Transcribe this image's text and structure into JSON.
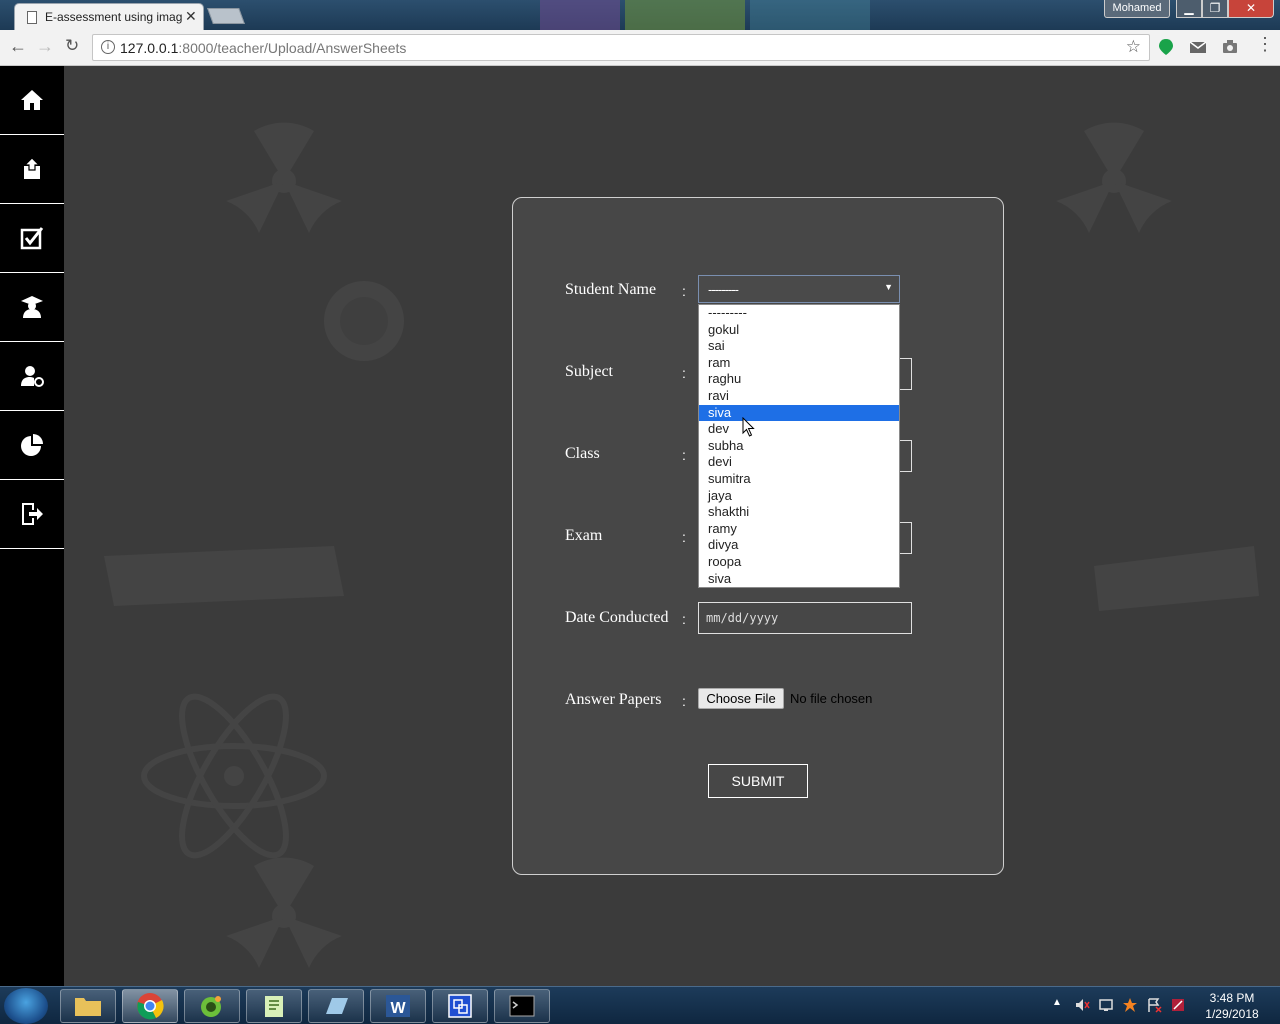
{
  "browser": {
    "tab_title": "E-assessment using imag",
    "user_name": "Mohamed",
    "url_host": "127.0.0.1",
    "url_rest": ":8000/teacher/Upload/AnswerSheets"
  },
  "sidebar": {
    "items": [
      {
        "icon": "home-icon"
      },
      {
        "icon": "upload-icon"
      },
      {
        "icon": "checkbox-icon"
      },
      {
        "icon": "student-icon"
      },
      {
        "icon": "user-settings-icon"
      },
      {
        "icon": "pie-chart-icon"
      },
      {
        "icon": "logout-icon"
      }
    ]
  },
  "form": {
    "student_label": "Student Name",
    "subject_label": "Subject",
    "class_label": "Class",
    "exam_label": "Exam",
    "date_label": "Date Conducted",
    "answers_label": "Answer Papers",
    "colon": ":",
    "student_selected": "---------",
    "date_placeholder": "mm/dd/yyyy",
    "choose_file": "Choose File",
    "no_file": "No file chosen",
    "submit": "SUBMIT"
  },
  "dropdown": {
    "options": [
      "---------",
      "gokul",
      "sai",
      "ram",
      "raghu",
      "ravi",
      "siva",
      "dev",
      "subha",
      "devi",
      "sumitra",
      "jaya",
      "shakthi",
      "ramy",
      "divya",
      "roopa",
      "siva"
    ],
    "highlighted": "siva"
  },
  "taskbar": {
    "time": "3:48 PM",
    "date": "1/29/2018"
  },
  "colors": {
    "accent": "#1e6fe6",
    "background": "#3b3b3b",
    "card": "#474747"
  }
}
